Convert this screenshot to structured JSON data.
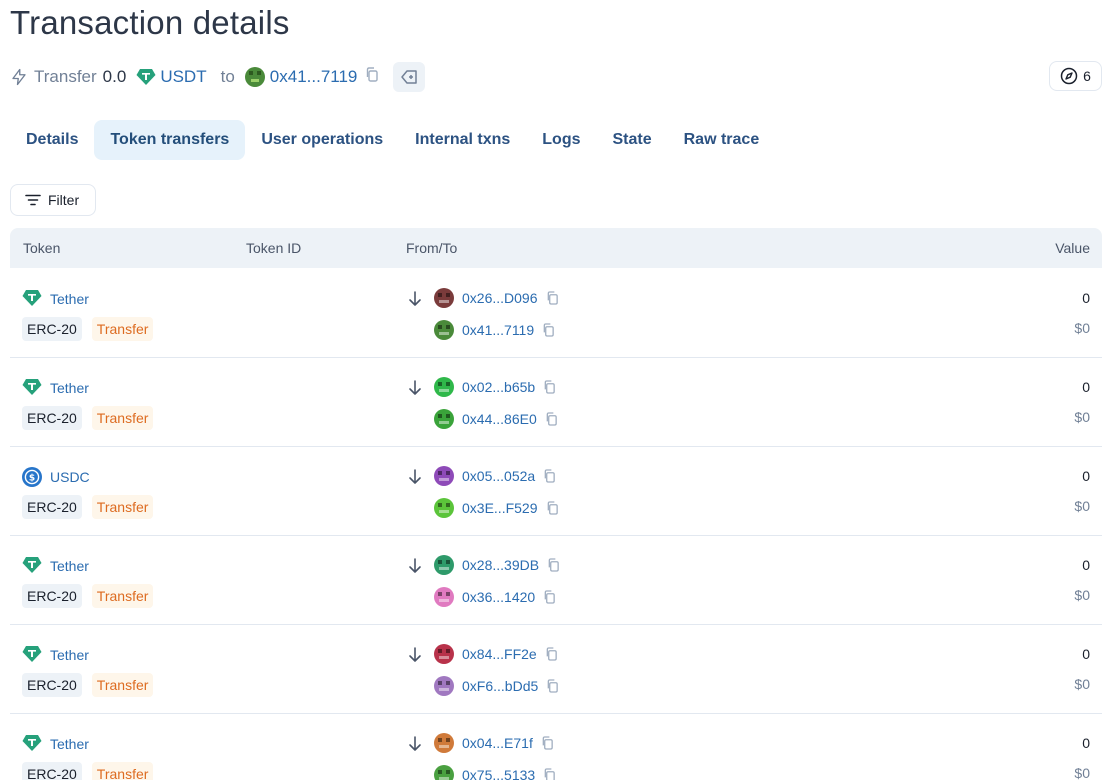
{
  "page_title": "Transaction details",
  "summary": {
    "action": "Transfer",
    "amount": "0.0",
    "token": "USDT",
    "to_label": "to",
    "to_address": "0x41...7119",
    "counter": "6"
  },
  "tabs": [
    {
      "label": "Details",
      "active": false
    },
    {
      "label": "Token transfers",
      "active": true
    },
    {
      "label": "User operations",
      "active": false
    },
    {
      "label": "Internal txns",
      "active": false
    },
    {
      "label": "Logs",
      "active": false
    },
    {
      "label": "State",
      "active": false
    },
    {
      "label": "Raw trace",
      "active": false
    }
  ],
  "filter_label": "Filter",
  "columns": {
    "token": "Token",
    "token_id": "Token ID",
    "from_to": "From/To",
    "value": "Value"
  },
  "rows": [
    {
      "token": "Tether",
      "token_icon": "tether-icon",
      "standard": "ERC-20",
      "kind": "Transfer",
      "from": "0x26...D096",
      "to": "0x41...7119",
      "value": "0",
      "usd": "$0",
      "from_color": "#7a3b3b",
      "to_color": "#4a8a3a"
    },
    {
      "token": "Tether",
      "token_icon": "tether-icon",
      "standard": "ERC-20",
      "kind": "Transfer",
      "from": "0x02...b65b",
      "to": "0x44...86E0",
      "value": "0",
      "usd": "$0",
      "from_color": "#2fb84a",
      "to_color": "#3aa33a"
    },
    {
      "token": "USDC",
      "token_icon": "usdc-icon",
      "standard": "ERC-20",
      "kind": "Transfer",
      "from": "0x05...052a",
      "to": "0x3E...F529",
      "value": "0",
      "usd": "$0",
      "from_color": "#8e4ab8",
      "to_color": "#5bc43a"
    },
    {
      "token": "Tether",
      "token_icon": "tether-icon",
      "standard": "ERC-20",
      "kind": "Transfer",
      "from": "0x28...39DB",
      "to": "0x36...1420",
      "value": "0",
      "usd": "$0",
      "from_color": "#2e9a6a",
      "to_color": "#e07ac0"
    },
    {
      "token": "Tether",
      "token_icon": "tether-icon",
      "standard": "ERC-20",
      "kind": "Transfer",
      "from": "0x84...FF2e",
      "to": "0xF6...bDd5",
      "value": "0",
      "usd": "$0",
      "from_color": "#b8324a",
      "to_color": "#a078c0"
    },
    {
      "token": "Tether",
      "token_icon": "tether-icon",
      "standard": "ERC-20",
      "kind": "Transfer",
      "from": "0x04...E71f",
      "to": "0x75...5133",
      "value": "0",
      "usd": "$0",
      "from_color": "#d07a3a",
      "to_color": "#4aa040"
    }
  ],
  "colors": {
    "link": "#2b6cb0",
    "tether": "#26a17b",
    "usdc": "#2775ca",
    "transfer_badge": "#dd6b20"
  }
}
